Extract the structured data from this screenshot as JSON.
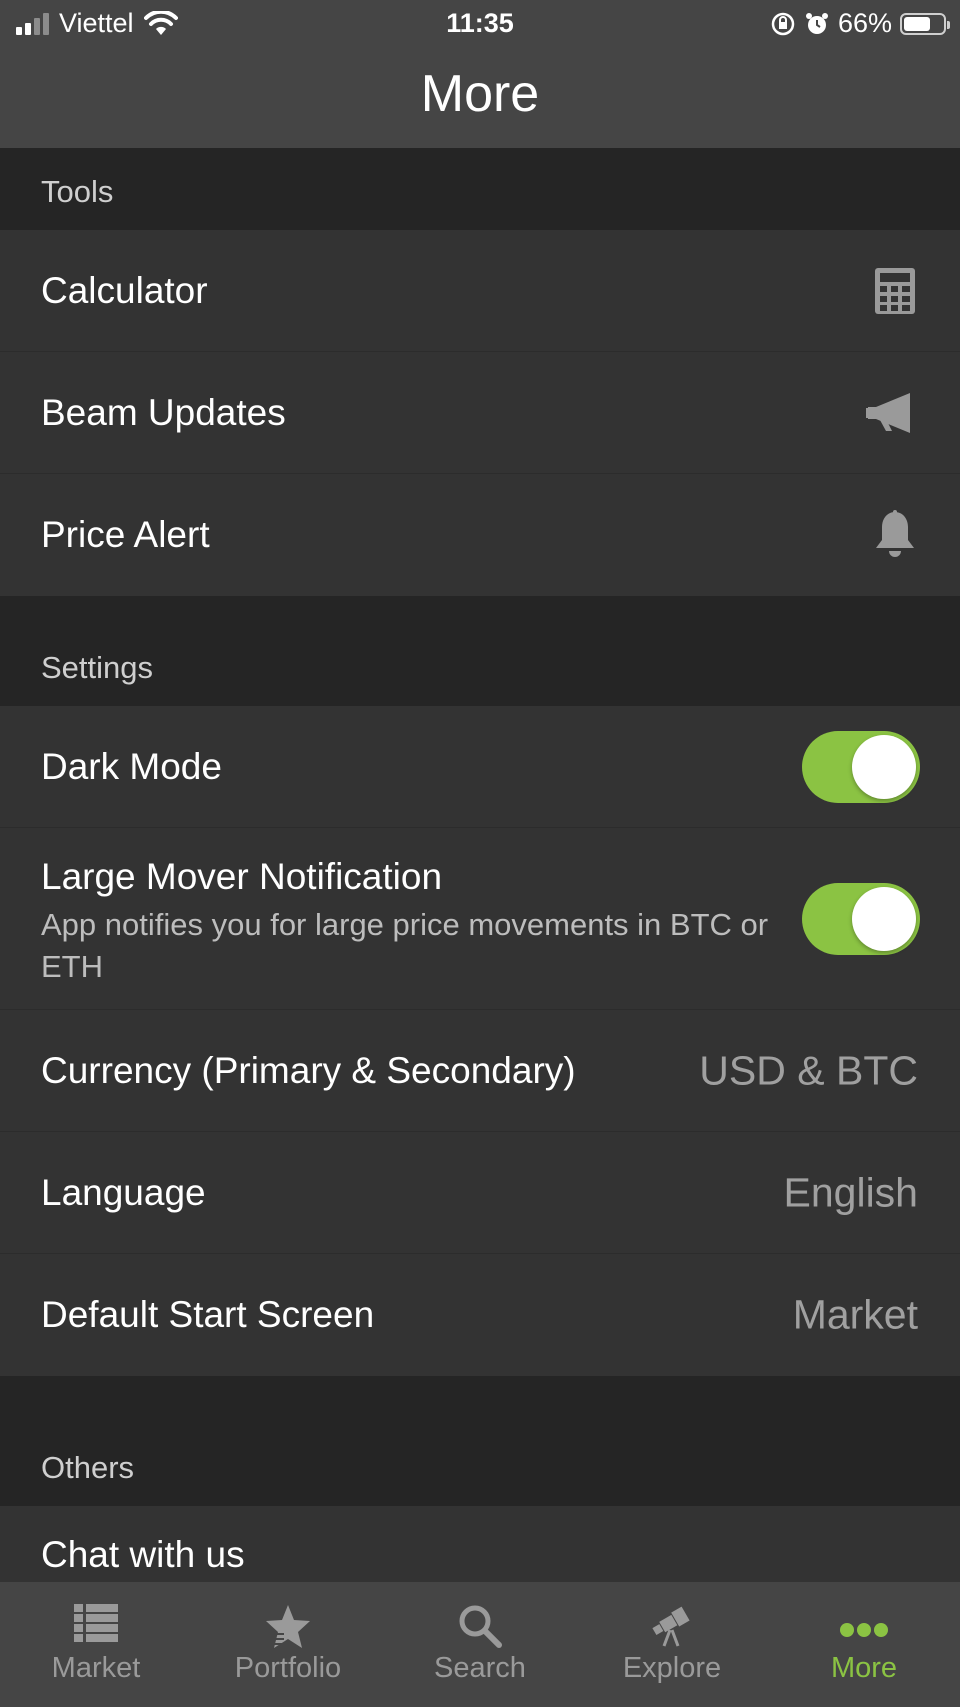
{
  "status_bar": {
    "carrier": "Viettel",
    "time": "11:35",
    "battery": "66%",
    "battery_level": 0.66
  },
  "header": {
    "title": "More"
  },
  "sections": {
    "tools": {
      "title": "Tools",
      "items": [
        {
          "label": "Calculator",
          "icon": "calculator-icon"
        },
        {
          "label": "Beam Updates",
          "icon": "megaphone-icon"
        },
        {
          "label": "Price Alert",
          "icon": "bell-icon"
        }
      ]
    },
    "settings": {
      "title": "Settings",
      "dark_mode": {
        "label": "Dark Mode",
        "on": true
      },
      "large_mover": {
        "label": "Large Mover Notification",
        "description": "App notifies you for large price movements in BTC or ETH",
        "on": true
      },
      "currency": {
        "label": "Currency (Primary & Secondary)",
        "value": "USD & BTC"
      },
      "language": {
        "label": "Language",
        "value": "English"
      },
      "start_screen": {
        "label": "Default Start Screen",
        "value": "Market"
      }
    },
    "others": {
      "title": "Others",
      "items": [
        {
          "label": "Chat with us"
        }
      ]
    }
  },
  "tabbar": {
    "tabs": [
      {
        "label": "Market",
        "icon": "list-icon"
      },
      {
        "label": "Portfolio",
        "icon": "star-icon"
      },
      {
        "label": "Search",
        "icon": "search-icon"
      },
      {
        "label": "Explore",
        "icon": "telescope-icon"
      },
      {
        "label": "More",
        "icon": "more-dots-icon",
        "active": true
      }
    ],
    "active_color": "#8bc343"
  },
  "colors": {
    "toggle_on": "#8bc343",
    "row_bg": "#333333",
    "header_bg": "#454545",
    "section_bg": "#252525"
  }
}
